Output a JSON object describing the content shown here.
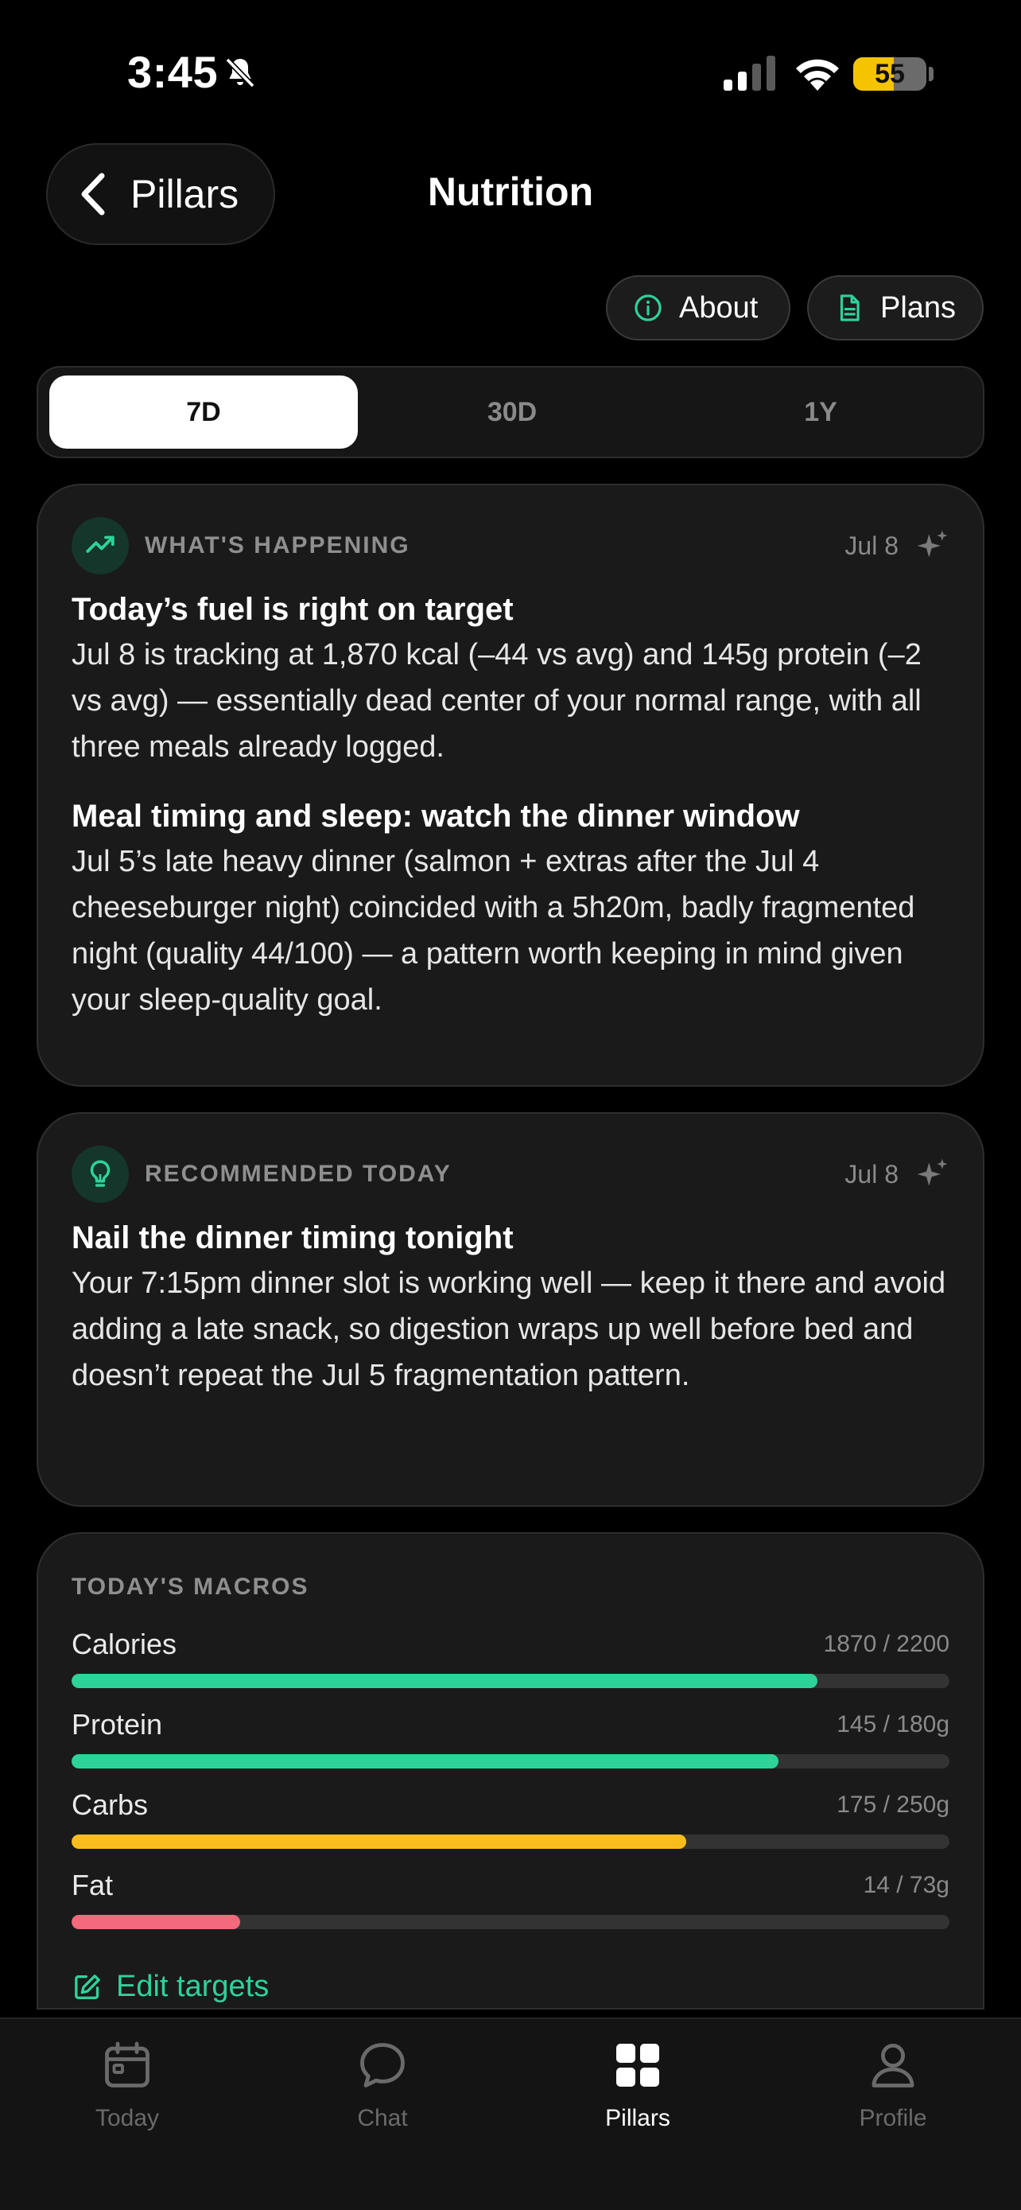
{
  "status_bar": {
    "time": "3:45",
    "battery": "55",
    "battery_level": 0.55,
    "icons": [
      "bell-slash-icon",
      "cellular-signal-icon",
      "wifi-icon",
      "battery-icon"
    ]
  },
  "header": {
    "back_label": "Pillars",
    "title": "Nutrition",
    "about_label": "About",
    "plans_label": "Plans"
  },
  "range_tabs": [
    {
      "label": "7D",
      "active": true
    },
    {
      "label": "30D",
      "active": false
    },
    {
      "label": "1Y",
      "active": false
    }
  ],
  "whats_happening": {
    "label": "WHAT'S HAPPENING",
    "date": "Jul 8",
    "blocks": [
      {
        "title": "Today’s fuel is right on target",
        "text": "Jul 8 is tracking at 1,870 kcal (–44 vs avg) and 145g protein (–2 vs avg) — essentially dead center of your normal range, with all three meals already logged."
      },
      {
        "title": "Meal timing and sleep: watch the dinner window",
        "text": "Jul 5’s late heavy dinner (salmon + extras after the Jul 4 cheeseburger night) coincided with a 5h20m, badly fragmented night (quality 44/100) — a pattern worth keeping in mind given your sleep-quality goal."
      }
    ]
  },
  "recommended": {
    "label": "RECOMMENDED TODAY",
    "date": "Jul 8",
    "title": "Nail the dinner timing tonight",
    "text": "Your 7:15pm dinner slot is working well — keep it there and avoid adding a late snack, so digestion wraps up well before bed and doesn’t repeat the Jul 5 fragmentation pattern."
  },
  "macros": {
    "label": "TODAY'S MACROS",
    "items": [
      {
        "name": "Calories",
        "value_text": "1870 / 2200",
        "current": 1870,
        "target": 2200,
        "color": "#2ed39a"
      },
      {
        "name": "Protein",
        "value_text": "145 / 180g",
        "current": 145,
        "target": 180,
        "color": "#2ed39a"
      },
      {
        "name": "Carbs",
        "value_text": "175 / 250g",
        "current": 175,
        "target": 250,
        "color": "#f9bd1e"
      },
      {
        "name": "Fat",
        "value_text": "14 / 73g",
        "current": 14,
        "target": 73,
        "color": "#f26a7b"
      }
    ],
    "edit_label": "Edit targets"
  },
  "tabbar": {
    "items": [
      {
        "label": "Today",
        "active": false
      },
      {
        "label": "Chat",
        "active": false
      },
      {
        "label": "Pillars",
        "active": true
      },
      {
        "label": "Profile",
        "active": false
      }
    ]
  },
  "colors": {
    "accent": "#2ed39a",
    "background": "#000000",
    "card": "#1a1a1a"
  }
}
